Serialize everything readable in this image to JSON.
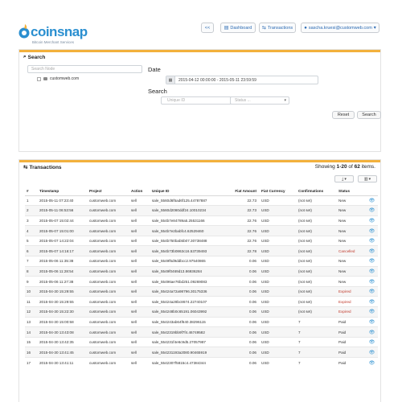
{
  "brand": {
    "name": "coinsnap",
    "tagline": "Bitcoin Merchant Services",
    "accent": "#2a8fd0",
    "panel_accent": "#f3b13c"
  },
  "nav": {
    "back_label": "<<",
    "dashboard_label": "Dashboard",
    "transactions_label": "Transactions",
    "user_label": "sascha.kruesi@customweb.com"
  },
  "search_panel": {
    "title": "Search",
    "tree_placeholder": "Search Node",
    "tree_item": "customweb.com",
    "date_label": "Date",
    "date_value": "2015-04-12 00:00:00 - 2015-05-11 23:59:59",
    "search_label": "Search",
    "uid_placeholder": "Unique ID",
    "status_placeholder": "Status ...",
    "reset_label": "Reset",
    "search_button_label": "Search"
  },
  "transactions_panel": {
    "title": "Transactions",
    "showing_prefix": "Showing ",
    "showing_range": "1-20",
    "showing_of": " of ",
    "showing_total": "62",
    "showing_suffix": " items.",
    "columns": [
      "#",
      "Timestamp",
      "Project",
      "Action",
      "Unique ID",
      "Fiat Amount",
      "Fiat Currency",
      "Confirmations",
      "Status",
      ""
    ],
    "rows": [
      [
        "1",
        "2015-05-11 07:23:40",
        "customweb.com",
        "sell",
        "sale_5560d6f5ad6f125.44787887",
        "22.73",
        "USD",
        "(not set)",
        "New"
      ],
      [
        "2",
        "2015-05-11 06:53:56",
        "customweb.com",
        "sell",
        "sale_5560d2080ddf24.10010234",
        "22.73",
        "USD",
        "(not set)",
        "New"
      ],
      [
        "3",
        "2015-05-07 15:02:44",
        "customweb.com",
        "sell",
        "sale_554b7e84789a5.25531166",
        "22.76",
        "USD",
        "(not set)",
        "New"
      ],
      [
        "4",
        "2015-05-07 15:01:00",
        "customweb.com",
        "sell",
        "sale_554b7e2babfc4.62529460",
        "22.76",
        "USD",
        "(not set)",
        "New"
      ],
      [
        "5",
        "2015-05-07 14:22:04",
        "customweb.com",
        "sell",
        "sale_554b750bab5b07.30738488",
        "22.76",
        "USD",
        "(not set)",
        "New"
      ],
      [
        "6",
        "2015-05-07 14:16:17",
        "customweb.com",
        "sell",
        "sale_554b73b0863c16.53739493",
        "22.78",
        "USD",
        "(not set)",
        "Cancelled"
      ],
      [
        "7",
        "2015-05-06 11:35:38",
        "customweb.com",
        "sell",
        "sale_5549f5d9ddbcc2.97540865",
        "0.06",
        "USD",
        "(not set)",
        "New"
      ],
      [
        "8",
        "2015-05-06 11:28:54",
        "customweb.com",
        "sell",
        "sale_5549f0469d13.86936284",
        "0.06",
        "USD",
        "(not set)",
        "New"
      ],
      [
        "9",
        "2015-05-06 11:27:38",
        "customweb.com",
        "sell",
        "sale_55496ae76bd251.09269083",
        "0.06",
        "USD",
        "(not set)",
        "New"
      ],
      [
        "10",
        "2015-04-30 15:29:55",
        "customweb.com",
        "sell",
        "sale_55424a72a98796.30175336",
        "0.06",
        "USD",
        "(not set)",
        "Expired"
      ],
      [
        "11",
        "2015-04-30 15:29:55",
        "customweb.com",
        "sell",
        "sale_55424a28bc8674.22740107",
        "0.06",
        "USD",
        "(not set)",
        "Expired"
      ],
      [
        "12",
        "2015-04-30 15:22:30",
        "customweb.com",
        "sell",
        "sale_554248b0c65191.06043992",
        "0.06",
        "USD",
        "(not set)",
        "Expired"
      ],
      [
        "13",
        "2015-04-30 15:00:58",
        "customweb.com",
        "sell",
        "sale_554243ab64f640.38296115",
        "0.06",
        "USD",
        "7",
        "Paid"
      ],
      [
        "14",
        "2015-04-30 13:43:08",
        "customweb.com",
        "sell",
        "sale_5542319bb9f7f4.46749582",
        "0.06",
        "USD",
        "7",
        "Paid"
      ],
      [
        "15",
        "2015-04-30 13:42:35",
        "customweb.com",
        "sell",
        "sale_554231f4e6c9d5.27057987",
        "0.06",
        "USD",
        "7",
        "Paid"
      ],
      [
        "16",
        "2015-04-30 13:41:45",
        "customweb.com",
        "sell",
        "sale_554231193a2080.90465919",
        "0.06",
        "USD",
        "7",
        "Paid"
      ],
      [
        "17",
        "2015-04-30 13:41:11",
        "customweb.com",
        "sell",
        "sale_5542307f5815c4.47384344",
        "0.06",
        "USD",
        "7",
        "Paid"
      ]
    ]
  }
}
